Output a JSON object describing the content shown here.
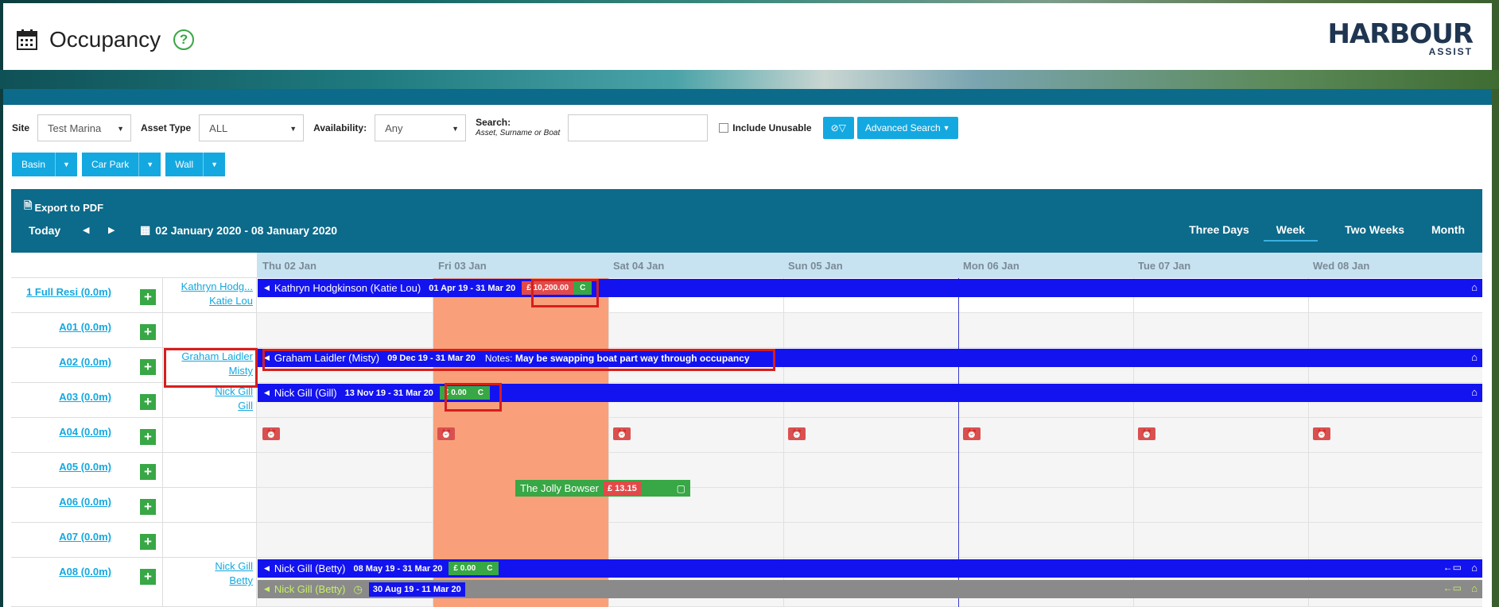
{
  "header": {
    "title": "Occupancy",
    "help": "?",
    "logo_main": "HARBOUR",
    "logo_sub": "ASSIST"
  },
  "filters": {
    "site_label": "Site",
    "site_value": "Test Marina",
    "asset_type_label": "Asset Type",
    "asset_type_value": "ALL",
    "availability_label": "Availability:",
    "availability_value": "Any",
    "search_label": "Search:",
    "search_hint": "Asset, Surname or Boat",
    "search_value": "",
    "include_unusable": "Include Unusable",
    "advanced_search": "Advanced Search"
  },
  "groups": [
    "Basin",
    "Car Park",
    "Wall"
  ],
  "toolbar": {
    "export": "Export to PDF",
    "today": "Today",
    "range": "02 January 2020 - 08 January 2020",
    "views": [
      "Three Days",
      "Week",
      "Two Weeks",
      "Month"
    ],
    "active_view": "Week"
  },
  "days": [
    "Thu 02 Jan",
    "Fri 03 Jan",
    "Sat 04 Jan",
    "Sun 05 Jan",
    "Mon 06 Jan",
    "Tue 07 Jan",
    "Wed 08 Jan"
  ],
  "rows": [
    {
      "asset": "1 Full Resi (0.0m)",
      "occ1": "Kathryn Hodg...",
      "occ2": "Katie Lou"
    },
    {
      "asset": "A01 (0.0m)",
      "occ1": "",
      "occ2": ""
    },
    {
      "asset": "A02 (0.0m)",
      "occ1": "Graham Laidler",
      "occ2": "Misty"
    },
    {
      "asset": "A03 (0.0m)",
      "occ1": "Nick Gill",
      "occ2": "Gill"
    },
    {
      "asset": "A04 (0.0m)",
      "occ1": "",
      "occ2": ""
    },
    {
      "asset": "A05 (0.0m)",
      "occ1": "",
      "occ2": ""
    },
    {
      "asset": "A06 (0.0m)",
      "occ1": "",
      "occ2": ""
    },
    {
      "asset": "A07 (0.0m)",
      "occ1": "",
      "occ2": ""
    },
    {
      "asset": "A08 (0.0m)",
      "occ1": "Nick Gill",
      "occ2": "Betty"
    }
  ],
  "bookings": {
    "kathryn": {
      "name": "Kathryn Hodgkinson (Katie Lou)",
      "dates": "01 Apr 19 - 31 Mar 20",
      "price": "£ 10,200.00",
      "status": "C"
    },
    "graham": {
      "name": "Graham Laidler (Misty)",
      "dates": "09 Dec 19 - 31 Mar 20",
      "notes_label": "Notes:",
      "notes": "May be swapping boat part way through occupancy"
    },
    "nick_gill": {
      "name": "Nick Gill (Gill)",
      "dates": "13 Nov 19 - 31 Mar 20",
      "price": "£ 0.00",
      "status": "C"
    },
    "jolly": {
      "name": "The Jolly Bowser",
      "price": "£ 13.15"
    },
    "nick_betty": {
      "name": "Nick Gill (Betty)",
      "dates": "08 May 19 - 31 Mar 20",
      "price": "£ 0.00",
      "status": "C"
    },
    "nick_betty_2": {
      "name": "Nick Gill (Betty)",
      "dates": "30 Aug 19 - 11 Mar 20"
    }
  }
}
